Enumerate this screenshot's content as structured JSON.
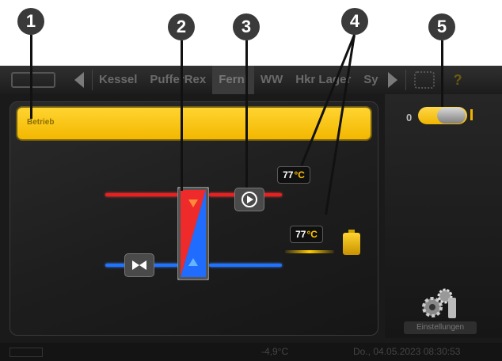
{
  "callouts": [
    "1",
    "2",
    "3",
    "4",
    "5"
  ],
  "navbar": {
    "tabs": [
      "Kessel",
      "PufferRex",
      "Fernl",
      "WW",
      "Hkr Lager",
      "Sy"
    ],
    "active_tab_index": 2
  },
  "yellow_bar": {
    "text": "Betrieb"
  },
  "temps": {
    "upper_value": "77",
    "upper_unit": "°C",
    "lower_value": "77",
    "lower_unit": "°C"
  },
  "toggle": {
    "off_label": "0",
    "state": "on"
  },
  "settings": {
    "label": "Einstellungen"
  },
  "status_bar": {
    "outside_temp": "-4,9°C",
    "datetime": "Do., 04.05.2023 08:30:53"
  },
  "icons": [
    "back-arrow-icon",
    "forward-arrow-icon",
    "help-icon",
    "pump-icon",
    "valve-icon",
    "heat-exchanger-icon",
    "battery-icon",
    "gear-icon"
  ]
}
